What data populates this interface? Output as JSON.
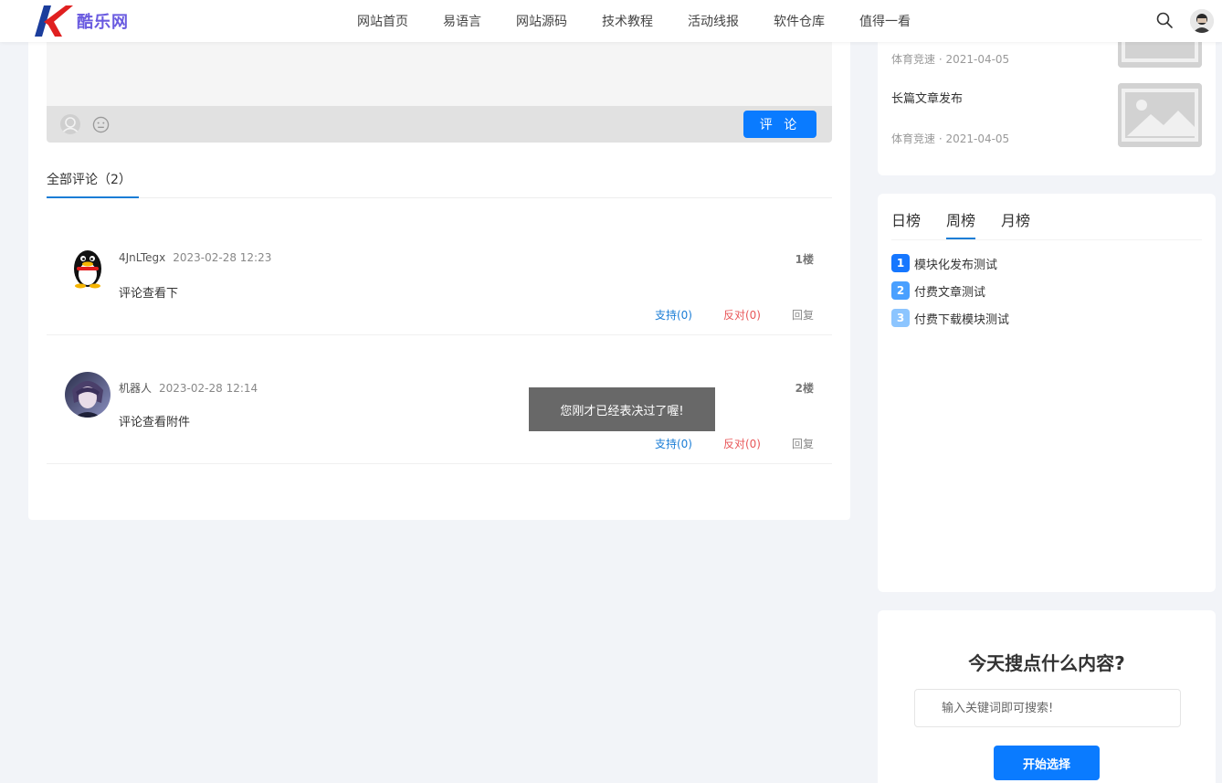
{
  "header": {
    "logo_text": "酷乐网",
    "nav": [
      "网站首页",
      "易语言",
      "网站源码",
      "技术教程",
      "活动线报",
      "软件仓库",
      "值得一看"
    ]
  },
  "editor": {
    "submit_label": "评 论"
  },
  "comments": {
    "tab_label": "全部评论（2）",
    "items": [
      {
        "user": "4JnLTegx",
        "date": "2023-02-28 12:23",
        "floor": "1楼",
        "text": "评论查看下",
        "support": "支持(0)",
        "oppose": "反对(0)",
        "reply": "回复"
      },
      {
        "user": "机器人",
        "date": "2023-02-28 12:14",
        "floor": "2楼",
        "text": "评论查看附件",
        "support": "支持(0)",
        "oppose": "反对(0)",
        "reply": "回复"
      }
    ]
  },
  "toast": "您刚才已经表决过了喔!",
  "sidebar": {
    "articles": [
      {
        "title": "",
        "meta": "体育竞速 · 2021-04-05"
      },
      {
        "title": "长篇文章发布",
        "meta": "体育竞速 · 2021-04-05"
      }
    ],
    "rank_tabs": [
      "日榜",
      "周榜",
      "月榜"
    ],
    "rank_items": [
      {
        "num": "1",
        "title": "模块化发布测试",
        "color": "#1677ff"
      },
      {
        "num": "2",
        "title": "付费文章测试",
        "color": "#4aa0ff"
      },
      {
        "num": "3",
        "title": "付费下载模块测试",
        "color": "#8cc5ff"
      }
    ],
    "search": {
      "title": "今天搜点什么内容?",
      "placeholder": "输入关键词即可搜索!",
      "button": "开始选择"
    }
  },
  "colors": {
    "accent": "#0a7bff",
    "tab_underline": "#1a7dd6",
    "oppose": "#e8585a"
  }
}
